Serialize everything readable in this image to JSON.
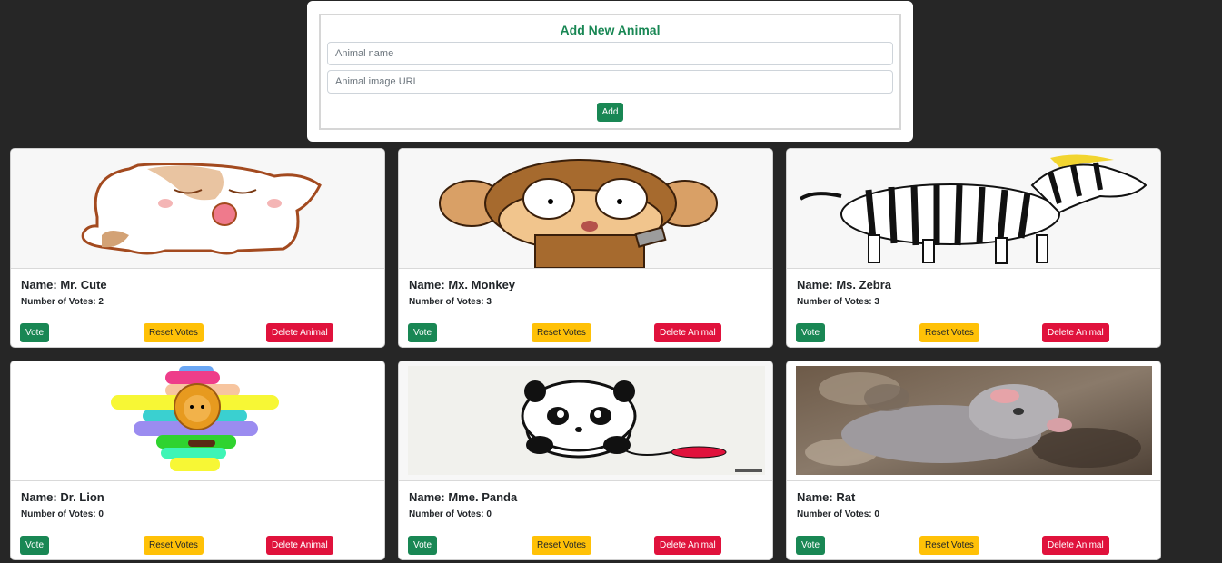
{
  "form": {
    "title": "Add New Animal",
    "name_placeholder": "Animal name",
    "url_placeholder": "Animal image URL",
    "add_label": "Add"
  },
  "labels": {
    "vote": "Vote",
    "reset": "Reset Votes",
    "delete": "Delete Animal"
  },
  "animals": [
    {
      "name": "Name: Mr. Cute",
      "votes": "Number of Votes: 2",
      "image": "cartoon-puppy"
    },
    {
      "name": "Name: Mx. Monkey",
      "votes": "Number of Votes: 3",
      "image": "cartoon-monkey"
    },
    {
      "name": "Name: Ms. Zebra",
      "votes": "Number of Votes: 3",
      "image": "cartoon-zebra"
    },
    {
      "name": "Name: Dr. Lion",
      "votes": "Number of Votes: 0",
      "image": "cartoon-lion"
    },
    {
      "name": "Name: Mme. Panda",
      "votes": "Number of Votes: 0",
      "image": "cartoon-panda"
    },
    {
      "name": "Name: Rat",
      "votes": "Number of Votes: 0",
      "image": "rat-photo"
    }
  ],
  "colors": {
    "background": "#262626",
    "primary_green": "#198754",
    "warning_yellow": "#ffc107",
    "danger_red": "#e0123c"
  }
}
